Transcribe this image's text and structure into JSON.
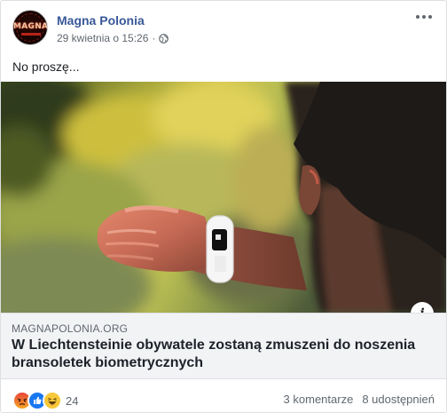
{
  "post": {
    "page_name": "Magna Polonia",
    "avatar_text": "MAGNA",
    "timestamp": "29 kwietnia o 15:26",
    "separator": "·",
    "privacy_icon": "globe-icon",
    "body_text": "No proszę...",
    "more_icon": "more-options-icon"
  },
  "link": {
    "domain": "MAGNAPOLONIA.ORG",
    "title": "W Liechtensteinie obywatele zostaną zmuszeni do noszenia bransoletek biometrycznych",
    "info_label": "i"
  },
  "footer": {
    "reactions": [
      "angry",
      "like",
      "haha"
    ],
    "reaction_count": "24",
    "comments": "3 komentarze",
    "shares": "8 udostępnień"
  }
}
